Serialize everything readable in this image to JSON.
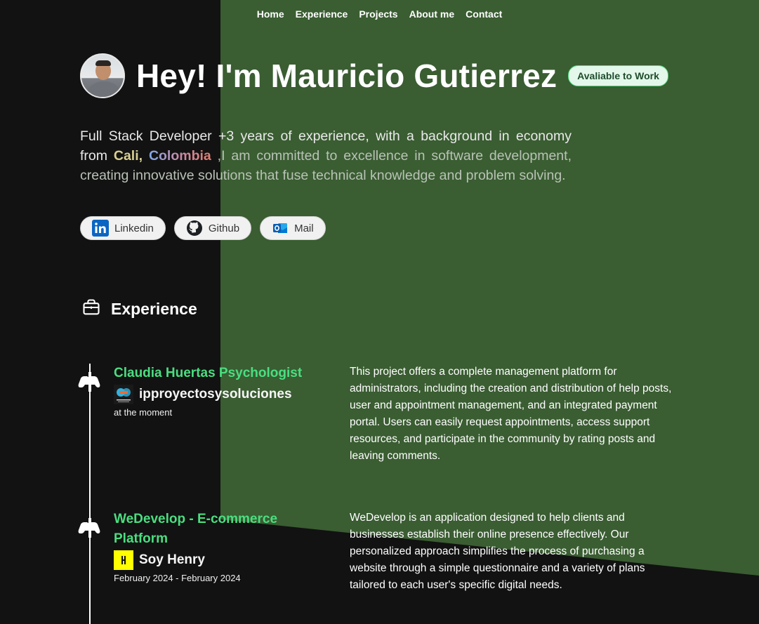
{
  "nav": [
    "Home",
    "Experience",
    "Projects",
    "About me",
    "Contact"
  ],
  "hero": {
    "title": "Hey! I'm Mauricio Gutierrez",
    "badge": "Avaliable to Work"
  },
  "intro": {
    "part1": "Full Stack Developer +3 years of experience, with a background in economy from ",
    "city": "Cali,",
    "country": "Colombia",
    "part2": " ,I am committed to excellence in software development, creating innovative solutions that fuse technical knowledge and problem solving."
  },
  "socials": [
    {
      "label": "Linkedin",
      "icon": "linkedin-icon"
    },
    {
      "label": "Github",
      "icon": "github-icon"
    },
    {
      "label": "Mail",
      "icon": "outlook-mail-icon"
    }
  ],
  "experience": {
    "heading": "Experience",
    "items": [
      {
        "title": "Claudia Huertas Psychologist",
        "company": "ipproyectosysoluciones",
        "date": "at the moment",
        "description": "This project offers a complete management platform for administrators, including the creation and distribution of help posts, user and appointment management, and an integrated payment portal. Users can easily request appointments, access support resources, and participate in the community by rating posts and leaving comments."
      },
      {
        "title": "WeDevelop - E-commerce Platform",
        "company": "Soy Henry",
        "date": "February 2024 - February 2024",
        "description": "WeDevelop is an application designed to help clients and businesses establish their online presence effectively. Our personalized approach simplifies the process of purchasing a website through a simple questionnaire and a variety of plans tailored to each user's specific digital needs."
      }
    ]
  },
  "colors": {
    "background": "#121212",
    "green_panel": "#3a5d32",
    "accent": "#4ade80"
  }
}
